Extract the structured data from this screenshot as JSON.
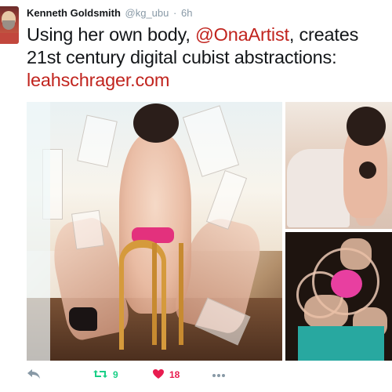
{
  "tweet": {
    "author_name": "Kenneth Goldsmith",
    "author_handle": "@kg_ubu",
    "separator": "·",
    "time": "6h",
    "text_before": "Using her own body,",
    "mention": "@OnaArtist",
    "text_middle": ", creates 21st century digital cubist abstractions:",
    "link": "leahschrager.com"
  },
  "actions": {
    "reply_icon": "reply-icon",
    "retweet_icon": "retweet-icon",
    "retweet_count": "9",
    "like_icon": "heart-icon",
    "like_count": "18",
    "more_icon": "more-icon"
  },
  "colors": {
    "link": "#c1241e",
    "retweet": "#19cf86",
    "like": "#e81c4f",
    "muted": "#8899a6"
  }
}
